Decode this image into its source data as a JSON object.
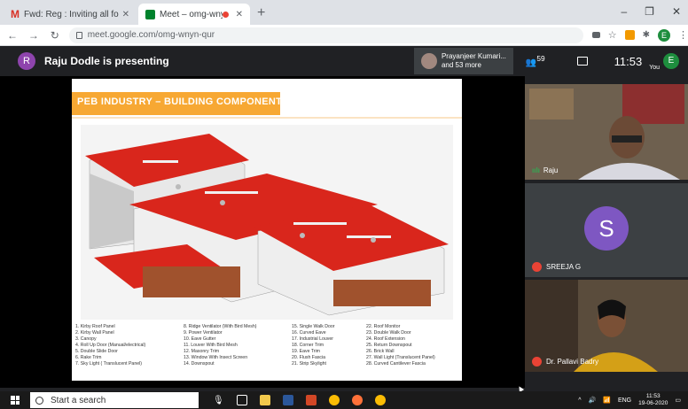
{
  "browser": {
    "tabs": [
      {
        "title": "Fwd: Reg : Inviting all for Google",
        "icon": "gmail-icon"
      },
      {
        "title": "Meet – omg-wnyn-qur",
        "icon": "meet-icon"
      }
    ],
    "url": "meet.google.com/omg-wnyn-qur",
    "new_tab": "+",
    "profile_initial": "E"
  },
  "meet": {
    "presenter_initial": "R",
    "presenting_text": "Raju Dodle is presenting",
    "participants_line1": "Prayanjeer Kumari...",
    "participants_line2": "and 53 more",
    "participant_count": "59",
    "clock": "11:53",
    "you_label": "You",
    "you_initial": "E"
  },
  "slide": {
    "title": "PEB INDUSTRY – BUILDING COMPONENTS",
    "legend_col1": [
      "1.   Kirby Roof Panel",
      "2.   Kirby Wall Panel",
      "3.   Canopy",
      "4.   Roll Up Door (Manual/electrical)",
      "5.   Double Slide Door",
      "6.   Rake Trim",
      "7.   Sky Light ( Translucent Panel)"
    ],
    "legend_col2": [
      "8.   Ridge Ventilator (With Bird Mesh)",
      "9.   Power Ventilator",
      "10.  Eave Gutter",
      "11.  Louver With Bird Mesh",
      "12.  Masonry Trim",
      "13.  Window With Insect Screen",
      "14.  Downspout"
    ],
    "legend_col3": [
      "15.  Single Walk Door",
      "16.  Curved Eave",
      "17.  Industrial Louver",
      "18.  Corner Trim",
      "19.  Eave Trim",
      "20.  Flush Fascia",
      "21.  Strip Skylight"
    ],
    "legend_col4": [
      "22.  Roof Monitor",
      "23.  Double Walk Door",
      "24.  Roof Extension",
      "25.  Return Downspout",
      "26.  Brick Wall",
      "27.  Wall Light (Translucent Panel)",
      "28.  Curved Cantilever Fascia"
    ]
  },
  "tiles": {
    "tile1_name": "Raju",
    "tile2_initial": "S",
    "tile2_name": "SREEJA G",
    "tile3_name": "Dr. Pallavi Badry"
  },
  "taskbar": {
    "search_placeholder": "Start a search",
    "lang": "ENG",
    "time": "11:53",
    "date": "19-06-2020"
  },
  "colors": {
    "roof_red": "#d9261c",
    "banner_orange": "#f7a833",
    "meet_bg": "#202124"
  }
}
